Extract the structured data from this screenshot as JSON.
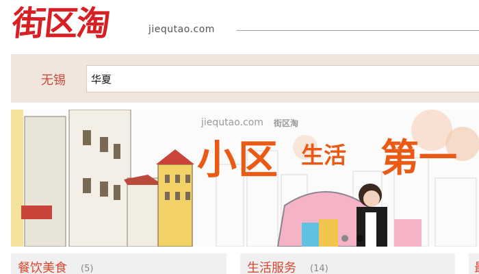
{
  "header": {
    "logo_text": "街区淘",
    "domain": "jiequtao.com"
  },
  "search": {
    "city": "无锡",
    "query": "华夏"
  },
  "banner": {
    "url_text": "jiequtao.com",
    "brand_text": "街区淘",
    "headline": "小区",
    "subline": "生活",
    "headline2": "第一",
    "active_slide": 2,
    "slide_count": 2
  },
  "categories": [
    {
      "title": "餐饮美食",
      "count": "(5)"
    },
    {
      "title": "生活服务",
      "count": "(14)"
    },
    {
      "title": "最",
      "count": ""
    }
  ],
  "colors": {
    "brand_red": "#d71f24",
    "search_bg": "#f0e6de",
    "banner_orange": "#ea5a14",
    "category_red": "#d9462e"
  }
}
